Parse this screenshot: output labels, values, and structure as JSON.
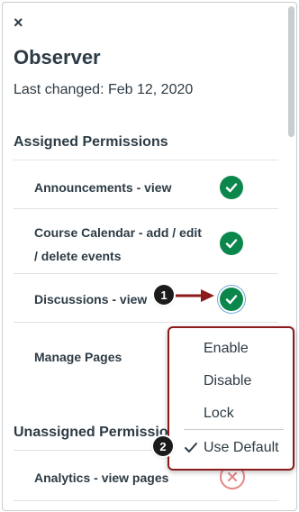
{
  "header": {
    "close_label": "×",
    "title": "Observer",
    "last_changed": "Last changed: Feb 12, 2020"
  },
  "assigned": {
    "heading": "Assigned Permissions",
    "rows": [
      {
        "label": "Announcements - view",
        "status": "enabled"
      },
      {
        "label": "Course Calendar - add / edit / delete events",
        "status": "enabled"
      },
      {
        "label": "Discussions - view",
        "status": "enabled"
      },
      {
        "label": "Manage Pages",
        "status": "enabled"
      }
    ]
  },
  "unassigned": {
    "heading": "Unassigned Permissions",
    "rows": [
      {
        "label": "Analytics - view pages",
        "status": "disabled"
      }
    ]
  },
  "menu": {
    "items": [
      "Enable",
      "Disable",
      "Lock"
    ],
    "default_label": "Use Default",
    "default_checked": true
  },
  "callouts": [
    "1",
    "2"
  ],
  "colors": {
    "enabled": "#0b874b",
    "disabled": "#e48585",
    "annotation": "#8b1a1a"
  }
}
